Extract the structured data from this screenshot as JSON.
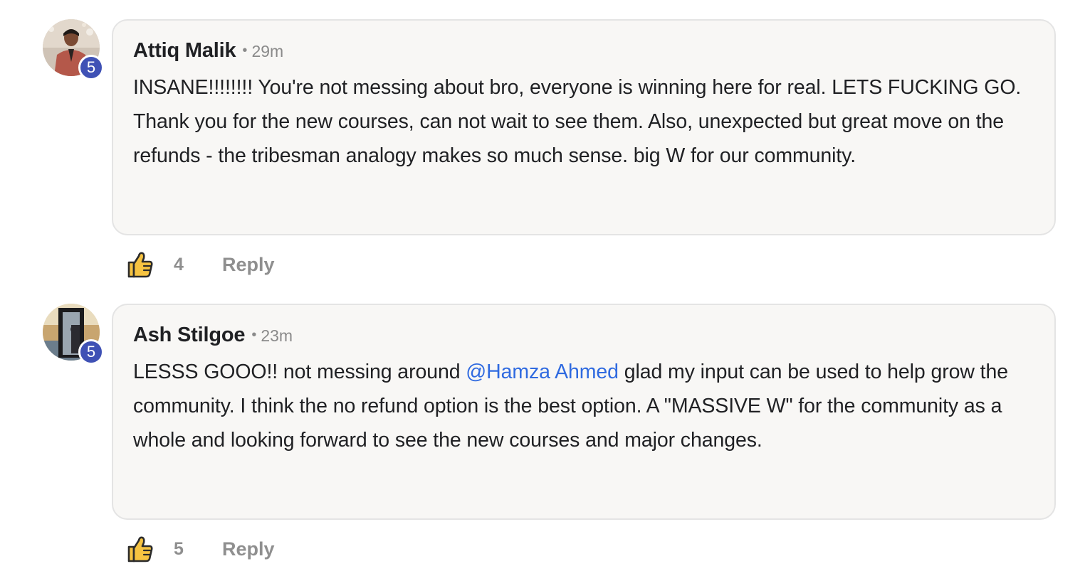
{
  "comments": [
    {
      "author": "Attiq Malik",
      "level": "5",
      "time": "29m",
      "text": "INSANE!!!!!!!! You're not messing about bro, everyone is winning here for real. LETS FUCKING GO. Thank you for the new courses, can not wait to see them. Also, unexpected but great move on the refunds - the tribesman analogy makes so much sense. big W for our community.",
      "likes": "4",
      "reply_label": "Reply"
    },
    {
      "author": "Ash Stilgoe",
      "level": "5",
      "time": "23m",
      "text_before": "LESSS GOOO!! not messing around ",
      "mention": "@Hamza Ahmed",
      "text_after": " glad my input can be used to help grow the community. I think the no refund option is the best option. A \"MASSIVE W\" for the community as a whole and looking forward to see the new courses and major changes.",
      "likes": "5",
      "reply_label": "Reply"
    }
  ],
  "colors": {
    "level_badge": "#3f51b5",
    "mention": "#2f6ae0",
    "like_icon": "#f6c341"
  },
  "icons": {
    "like": "thumbs-up-icon"
  }
}
